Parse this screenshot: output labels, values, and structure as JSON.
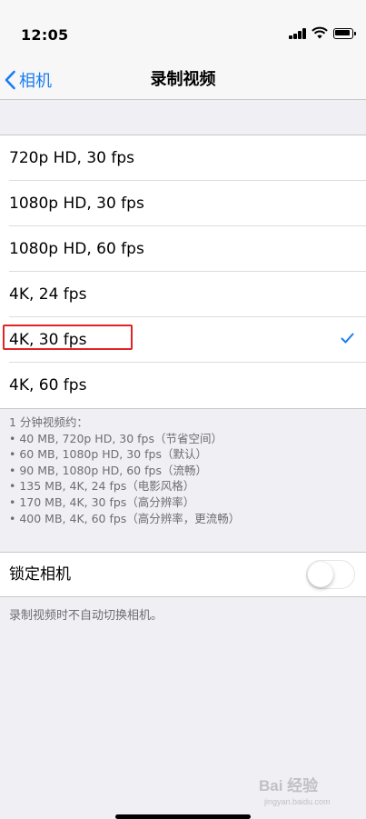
{
  "status_bar": {
    "time": "12:05"
  },
  "nav": {
    "back_label": "相机",
    "title": "录制视频"
  },
  "formats": [
    {
      "label": "720p HD, 30 fps",
      "selected": false
    },
    {
      "label": "1080p HD, 30 fps",
      "selected": false
    },
    {
      "label": "1080p HD, 60 fps",
      "selected": false
    },
    {
      "label": "4K, 24 fps",
      "selected": false
    },
    {
      "label": "4K, 30 fps",
      "selected": true
    },
    {
      "label": "4K, 60 fps",
      "selected": false
    }
  ],
  "footnote": {
    "heading": "1 分钟视频约：",
    "lines": [
      "• 40 MB, 720p HD, 30 fps（节省空间）",
      "• 60 MB, 1080p HD, 30 fps（默认）",
      "• 90 MB, 1080p HD, 60 fps（流畅）",
      "• 135 MB, 4K, 24 fps（电影风格）",
      "• 170 MB, 4K, 30 fps（高分辨率）",
      "• 400 MB, 4K, 60 fps（高分辨率，更流畅）"
    ]
  },
  "lock_camera": {
    "label": "锁定相机",
    "enabled": false,
    "footnote": "录制视频时不自动切换相机。"
  },
  "watermark": {
    "text": "Bai 经验",
    "url_text": "jingyan.baidu.com"
  },
  "colors": {
    "accent": "#1a7cf5",
    "highlight": "#e02424",
    "background": "#efeff4"
  }
}
